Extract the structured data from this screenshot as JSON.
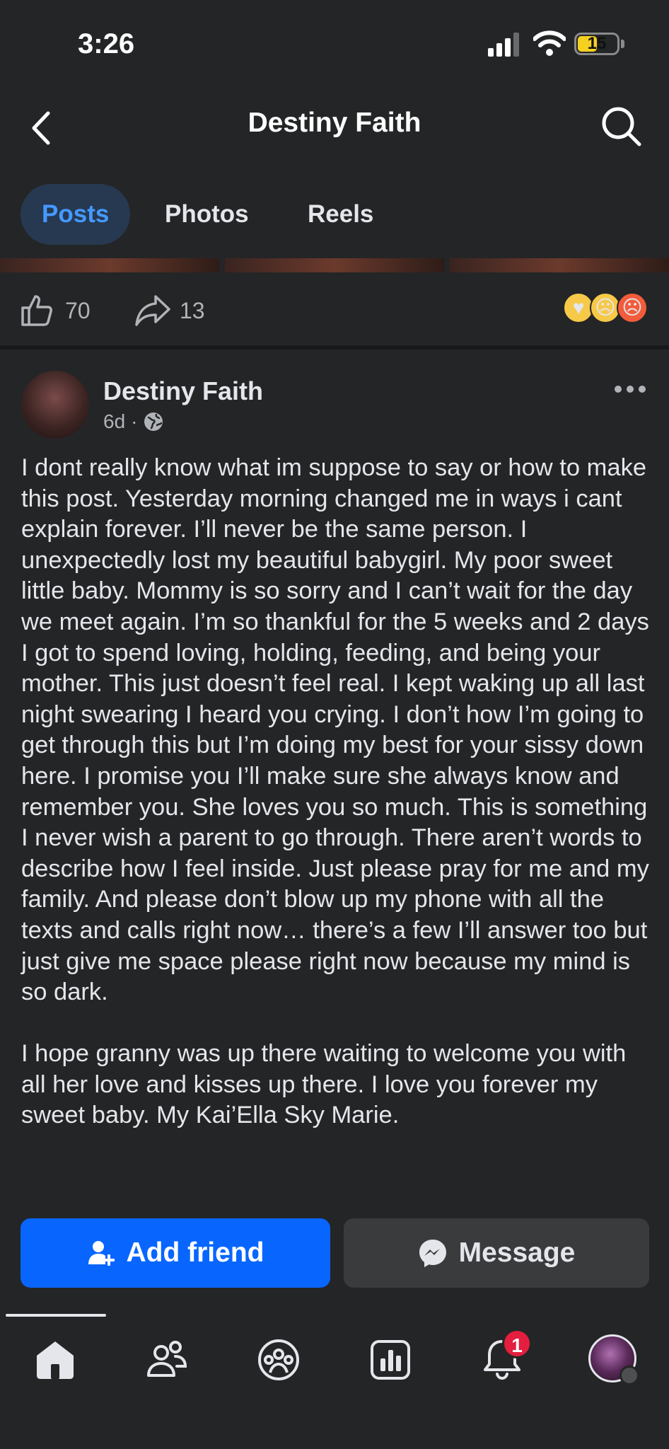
{
  "status_bar": {
    "time": "3:26",
    "battery": "15",
    "battery_color": "#f5d020"
  },
  "header": {
    "title": "Destiny Faith",
    "back_icon": "chevron-left-icon",
    "search_icon": "search-icon"
  },
  "tabs": [
    {
      "label": "Posts",
      "active": true
    },
    {
      "label": "Photos",
      "active": false
    },
    {
      "label": "Reels",
      "active": false
    }
  ],
  "prev_post_actions": {
    "like_count": "70",
    "share_count": "13",
    "reactions": [
      "care-emoji",
      "sad-emoji",
      "angry-emoji"
    ]
  },
  "post": {
    "author": "Destiny Faith",
    "age": "6d",
    "separator": "·",
    "audience_icon": "globe-icon",
    "text": "I dont really know what im suppose to say or how to make this post. Yesterday morning changed me in ways i cant explain forever. I’ll never be the same person. I unexpectedly lost my beautiful babygirl. My poor sweet little baby. Mommy is so sorry and I can’t wait for the day we meet again. I’m so thankful for the 5 weeks and 2 days I got to spend loving, holding, feeding, and being your mother. This just doesn’t feel real. I kept waking up all last night swearing I heard you crying. I don’t how I’m going to get through this but I’m doing my best for your sissy down here. I promise you I’ll make sure she always know and remember you. She loves you so much. This is something I never wish a parent to go through. There aren’t words to describe how I feel inside. Just please pray for me and my family. And please don’t blow up my phone with all the texts and calls right now… there’s a few I’ll answer too but just give me space please right now because my mind is so dark.\n\nI hope granny was up there waiting to welcome you with all her love and kisses up there. I love you forever my sweet baby. My Kai’Ella Sky Marie."
  },
  "buttons": {
    "add_friend": "Add friend",
    "message": "Message",
    "primary_color": "#0866ff"
  },
  "bottom_nav": {
    "items": [
      "home-icon",
      "friends-icon",
      "groups-icon",
      "dashboard-icon",
      "notifications-icon",
      "profile-avatar"
    ],
    "notification_badge": "1"
  }
}
